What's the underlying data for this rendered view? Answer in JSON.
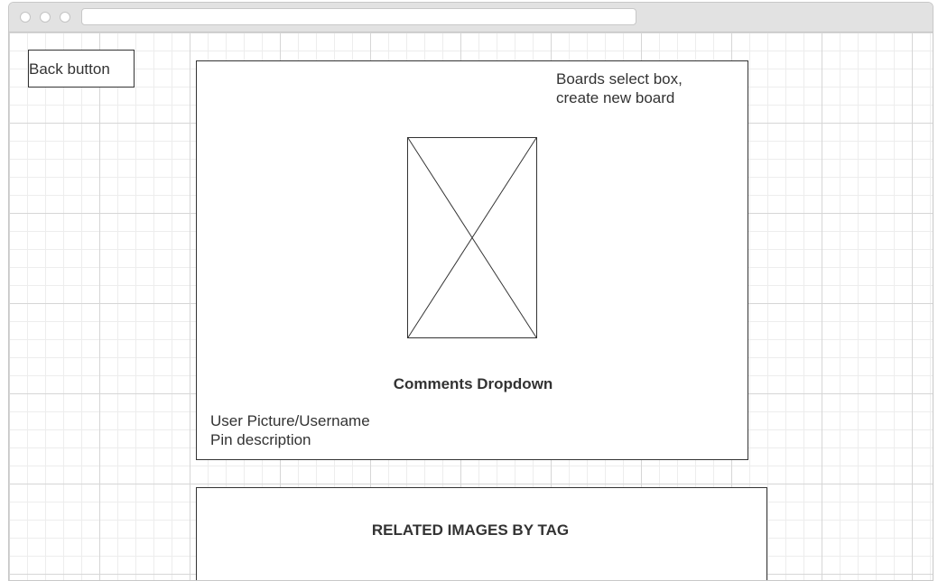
{
  "back": {
    "label": "Back button"
  },
  "pin": {
    "boards_line1": "Boards select box,",
    "boards_line2": "create new board",
    "comments_label": "Comments Dropdown",
    "user_label": "User Picture/Username",
    "description_label": "Pin description"
  },
  "related": {
    "title": "RELATED IMAGES BY TAG"
  }
}
